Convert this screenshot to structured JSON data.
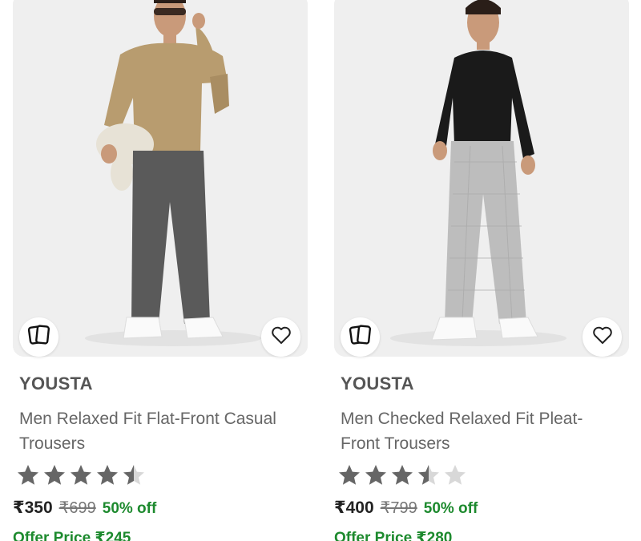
{
  "products": [
    {
      "brand": "YOUSTA",
      "title": "Men Relaxed Fit Flat-Front Casual Trousers",
      "rating": 4.5,
      "price": "₹350",
      "mrp": "₹699",
      "discount": "50% off",
      "offer_price": "Offer Price ₹245",
      "compare_icon": "compare-cards-icon",
      "wishlist_icon": "heart-outline-icon",
      "colors": {
        "top": "#b89c6f",
        "trousers": "#5a5a5a"
      }
    },
    {
      "brand": "YOUSTA",
      "title": "Men Checked Relaxed Fit Pleat-Front Trousers",
      "rating": 3.5,
      "price": "₹400",
      "mrp": "₹799",
      "discount": "50% off",
      "offer_price": "Offer Price ₹280",
      "compare_icon": "compare-cards-icon",
      "wishlist_icon": "heart-outline-icon",
      "colors": {
        "top": "#1a1a1a",
        "trousers": "#bdbdbd"
      }
    }
  ],
  "theme": {
    "discount_color": "#1d8a2e",
    "star_filled": "#666666",
    "star_empty": "#d8d8d8"
  }
}
